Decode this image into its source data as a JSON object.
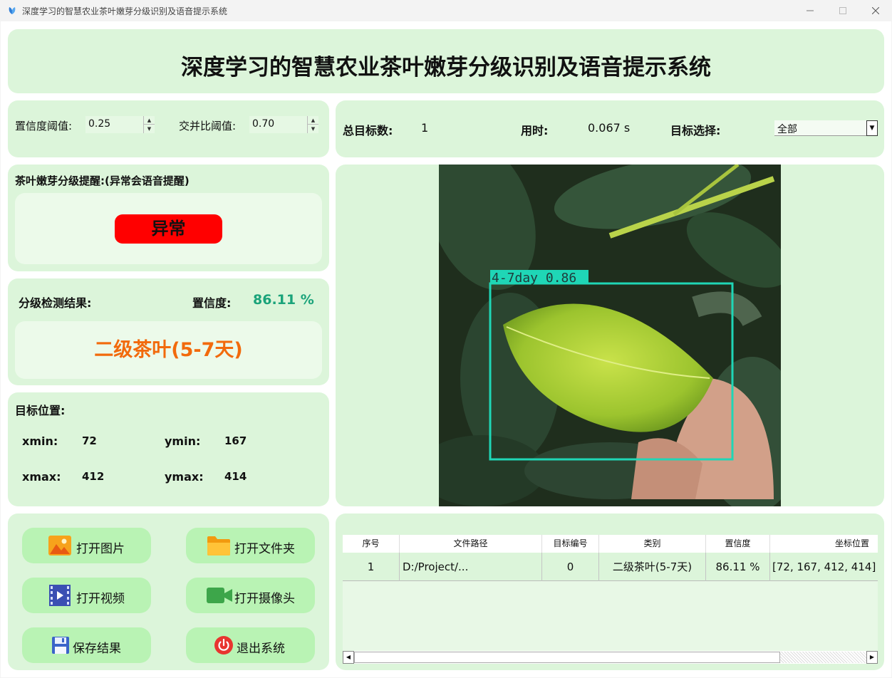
{
  "window": {
    "title": "深度学习的智慧农业茶叶嫩芽分级识别及语音提示系统",
    "minimize": "—",
    "maximize": "☐",
    "close": "✕"
  },
  "header": {
    "title": "深度学习的智慧农业茶叶嫩芽分级识别及语音提示系统"
  },
  "params": {
    "conf_label": "置信度阈值:",
    "conf_value": "0.25",
    "iou_label": "交并比阈值:",
    "iou_value": "0.70"
  },
  "stats": {
    "total_label": "总目标数:",
    "total_value": "1",
    "time_label": "用时:",
    "time_value": "0.067 s",
    "target_label": "目标选择:",
    "target_selected": "全部"
  },
  "alert": {
    "title": "茶叶嫩芽分级提醒:(异常会语音提醒)",
    "status": "异常",
    "status_color": "#ff0000"
  },
  "result": {
    "label": "分级检测结果:",
    "conf_label": "置信度:",
    "conf_value": "86.11 %",
    "class_name": "二级茶叶(5-7天)",
    "class_color": "#f26a0c"
  },
  "position": {
    "title": "目标位置:",
    "xmin_label": "xmin:",
    "xmin": "72",
    "ymin_label": "ymin:",
    "ymin": "167",
    "xmax_label": "xmax:",
    "xmax": "412",
    "ymax_label": "ymax:",
    "ymax": "414"
  },
  "detection": {
    "box_label": "4-7day 0.86",
    "box_color": "#1fd6b6"
  },
  "buttons": {
    "open_image": "打开图片",
    "open_folder": "打开文件夹",
    "open_video": "打开视频",
    "open_camera": "打开摄像头",
    "save": "保存结果",
    "exit": "退出系统"
  },
  "table": {
    "columns": [
      "序号",
      "文件路径",
      "目标编号",
      "类别",
      "置信度",
      "坐标位置"
    ],
    "rows": [
      [
        "1",
        "D:/Project/...",
        "0",
        "二级茶叶(5-7天)",
        "86.11 %",
        "[72, 167, 412, 414]"
      ]
    ]
  },
  "colors": {
    "panel_bg": "#dcf5da",
    "button_bg": "#b9f3b4",
    "confidence_text": "#1aa37a"
  }
}
